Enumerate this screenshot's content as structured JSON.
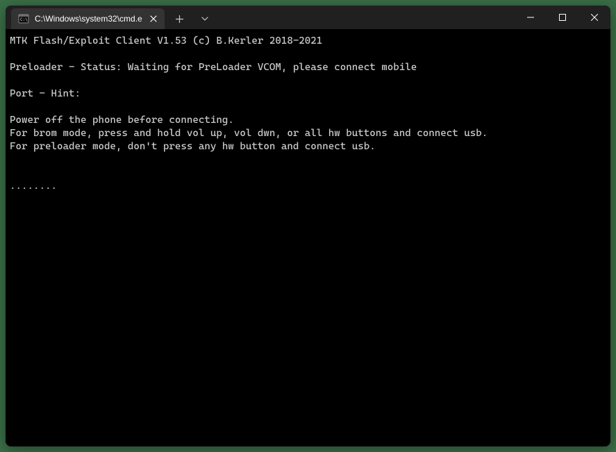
{
  "tab": {
    "title": "C:\\Windows\\system32\\cmd.e"
  },
  "terminal": {
    "lines": [
      "MTK Flash/Exploit Client V1.53 (c) B.Kerler 2018-2021",
      "",
      "Preloader - Status: Waiting for PreLoader VCOM, please connect mobile",
      "",
      "Port - Hint:",
      "",
      "Power off the phone before connecting.",
      "For brom mode, press and hold vol up, vol dwn, or all hw buttons and connect usb.",
      "For preloader mode, don't press any hw button and connect usb.",
      "",
      "",
      "........"
    ]
  }
}
